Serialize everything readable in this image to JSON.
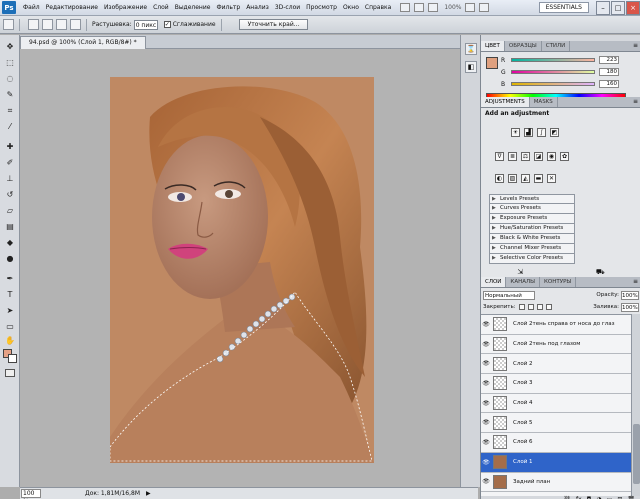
{
  "menubar": {
    "logo": "Ps",
    "items": [
      "Файл",
      "Редактирование",
      "Изображение",
      "Слой",
      "Выделение",
      "Фильтр",
      "Анализ",
      "3D-слои",
      "Просмотр",
      "Окно",
      "Справка"
    ],
    "zoom": "100%",
    "workspace": "ESSENTIALS",
    "window_controls": [
      "–",
      "□",
      "×"
    ]
  },
  "options": {
    "feather_label": "Растушевка:",
    "feather_value": "0 пикс",
    "smoothing_label": "Сглаживание",
    "smoothing_checked": "✓",
    "refine_label": "Уточнить край..."
  },
  "document": {
    "tab": "94.psd @ 100% (Слой 1, RGB/8#) *",
    "status_zoom": "100 %",
    "status_info": "Док: 1,81M/16,8M",
    "status_arrow": "▶"
  },
  "color": {
    "tabs": [
      "ЦВЕТ",
      "ОБРАЗЦЫ",
      "СТИЛИ"
    ],
    "fg": "#dfa07f",
    "channels": [
      {
        "letter": "R",
        "value": "223"
      },
      {
        "letter": "G",
        "value": "180"
      },
      {
        "letter": "B",
        "value": "160"
      }
    ]
  },
  "adjustments": {
    "tabs": [
      "ADJUSTMENTS",
      "MASKS"
    ],
    "title": "Add an adjustment",
    "presets": [
      "Levels Presets",
      "Curves Presets",
      "Exposure Presets",
      "Hue/Saturation Presets",
      "Black & White Presets",
      "Channel Mixer Presets",
      "Selective Color Presets"
    ]
  },
  "layers": {
    "tabs": [
      "СЛОИ",
      "КАНАЛЫ",
      "КОНТУРЫ"
    ],
    "blend_mode": "Нормальный",
    "opacity_label": "Opacity:",
    "opacity": "100%",
    "lock_label": "Закрепить:",
    "fill_label": "Заливка:",
    "fill": "100%",
    "items": [
      {
        "name": "Слой 2тень справа от носа до глаз",
        "selected": false
      },
      {
        "name": "Слой 2тень под глазом",
        "selected": false
      },
      {
        "name": "Слой 2",
        "selected": false
      },
      {
        "name": "Слой 3",
        "selected": false
      },
      {
        "name": "Слой 4",
        "selected": false
      },
      {
        "name": "Слой 5",
        "selected": false
      },
      {
        "name": "Слой 6",
        "selected": false
      },
      {
        "name": "Слой 1",
        "selected": true
      },
      {
        "name": "Задний план",
        "selected": false
      }
    ]
  }
}
